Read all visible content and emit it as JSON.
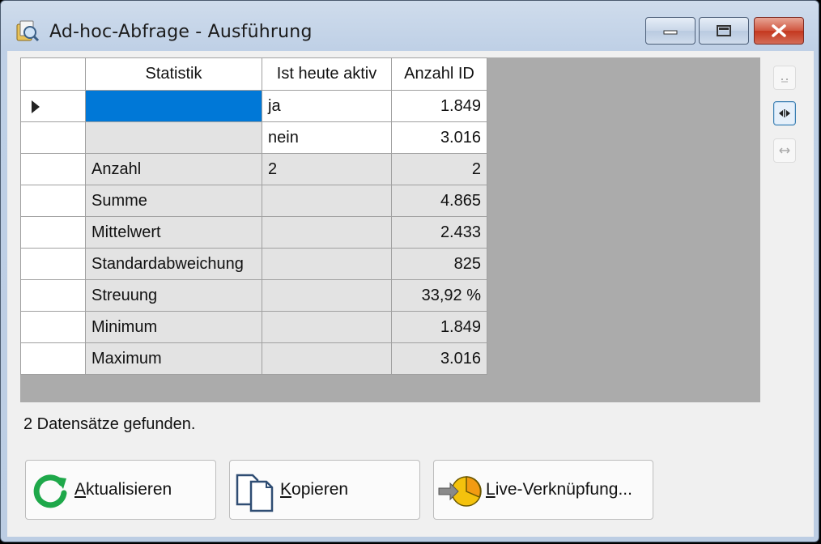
{
  "window": {
    "title": "Ad-hoc-Abfrage - Ausführung",
    "controls": {
      "minimize": "minimize",
      "maximize": "maximize",
      "close": "close"
    }
  },
  "grid": {
    "columns": [
      "Statistik",
      "Ist heute aktiv",
      "Anzahl ID"
    ],
    "rows": [
      {
        "statistik": "",
        "aktiv": "ja",
        "anzahl": "1.849",
        "current": true
      },
      {
        "statistik": "",
        "aktiv": "nein",
        "anzahl": "3.016"
      },
      {
        "statistik": "Anzahl",
        "aktiv": "2",
        "anzahl": "2"
      },
      {
        "statistik": "Summe",
        "aktiv": "",
        "anzahl": "4.865"
      },
      {
        "statistik": "Mittelwert",
        "aktiv": "",
        "anzahl": "2.433"
      },
      {
        "statistik": "Standardabweichung",
        "aktiv": "",
        "anzahl": "825"
      },
      {
        "statistik": "Streuung",
        "aktiv": "",
        "anzahl": "33,92 %"
      },
      {
        "statistik": "Minimum",
        "aktiv": "",
        "anzahl": "1.849"
      },
      {
        "statistik": "Maximum",
        "aktiv": "",
        "anzahl": "3.016"
      }
    ]
  },
  "side_buttons": [
    "autosize-columns-icon",
    "fit-columns-icon",
    "expand-columns-icon"
  ],
  "status": "2 Datensätze gefunden.",
  "buttons": {
    "refresh": {
      "mnemonic": "A",
      "rest": "ktualisieren"
    },
    "copy": {
      "mnemonic": "K",
      "rest": "opieren"
    },
    "live": {
      "mnemonic": "L",
      "rest": "ive-Verknüpfung..."
    }
  },
  "colors": {
    "selection": "#0078d7",
    "close_button": "#c4371e",
    "grid_background": "#ababab"
  }
}
